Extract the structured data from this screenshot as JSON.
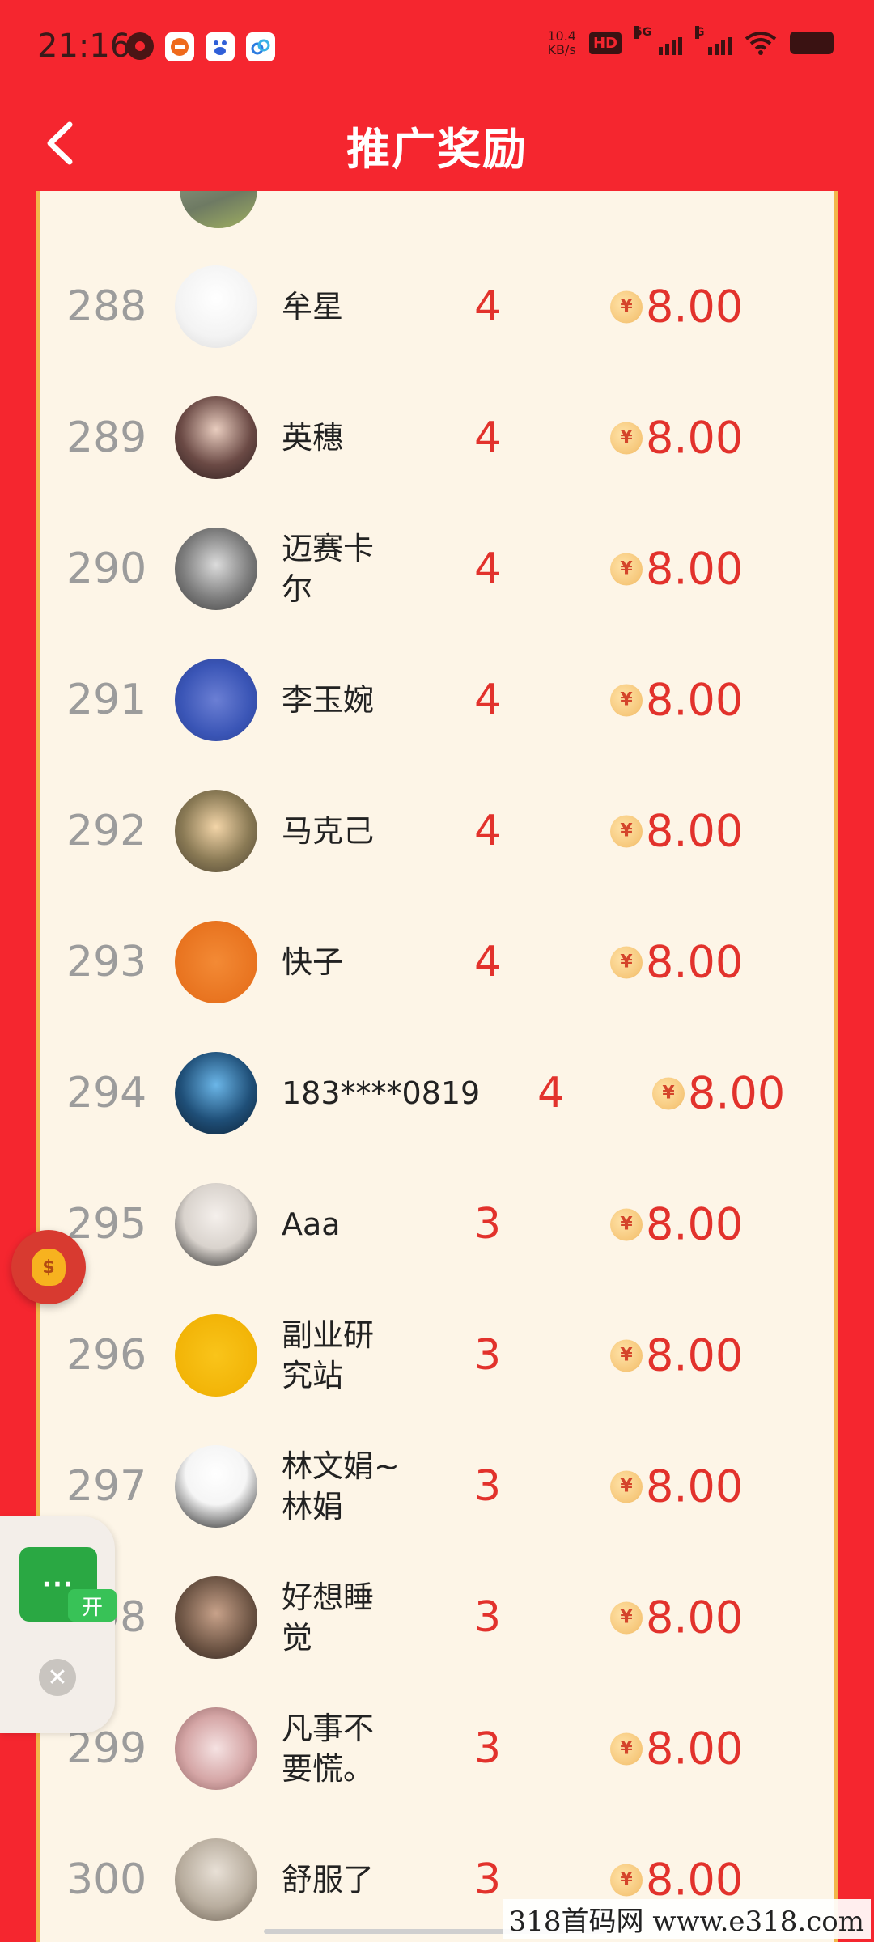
{
  "status_bar": {
    "time": "21:16",
    "net_speed_value": "10.4",
    "net_speed_unit": "KB/s",
    "hd_label": "HD",
    "sim1_label": "5G",
    "sim2_label": "G"
  },
  "header": {
    "title": "推广奖励"
  },
  "rows": [
    {
      "rank": "288",
      "name": "牟星",
      "count": "4",
      "amount": "8.00"
    },
    {
      "rank": "289",
      "name": "英穗",
      "count": "4",
      "amount": "8.00"
    },
    {
      "rank": "290",
      "name": "迈赛卡尔",
      "count": "4",
      "amount": "8.00"
    },
    {
      "rank": "291",
      "name": "李玉婉",
      "count": "4",
      "amount": "8.00"
    },
    {
      "rank": "292",
      "name": "马克己",
      "count": "4",
      "amount": "8.00"
    },
    {
      "rank": "293",
      "name": "快子",
      "count": "4",
      "amount": "8.00"
    },
    {
      "rank": "294",
      "name": "183****0819",
      "count": "4",
      "amount": "8.00"
    },
    {
      "rank": "295",
      "name": "Aaa",
      "count": "3",
      "amount": "8.00"
    },
    {
      "rank": "296",
      "name": "副业研究站",
      "count": "3",
      "amount": "8.00"
    },
    {
      "rank": "297",
      "name": "林文娟~林娟",
      "count": "3",
      "amount": "8.00"
    },
    {
      "rank": "298",
      "name": "好想睡觉",
      "count": "3",
      "amount": "8.00"
    },
    {
      "rank": "299",
      "name": "凡事不要慌。",
      "count": "3",
      "amount": "8.00"
    },
    {
      "rank": "300",
      "name": "舒服了",
      "count": "3",
      "amount": "8.00"
    }
  ],
  "coin_symbol": "¥",
  "floating": {
    "money_symbol": "$",
    "wechat_label": "···",
    "open_label": "开",
    "close_symbol": "✕"
  },
  "watermark": "318首码网  www.e318.com",
  "colors": {
    "background": "#f5262f",
    "panel": "#fdf5e7",
    "accent_red": "#e2322c",
    "rank_gray": "#9c9c9c"
  }
}
